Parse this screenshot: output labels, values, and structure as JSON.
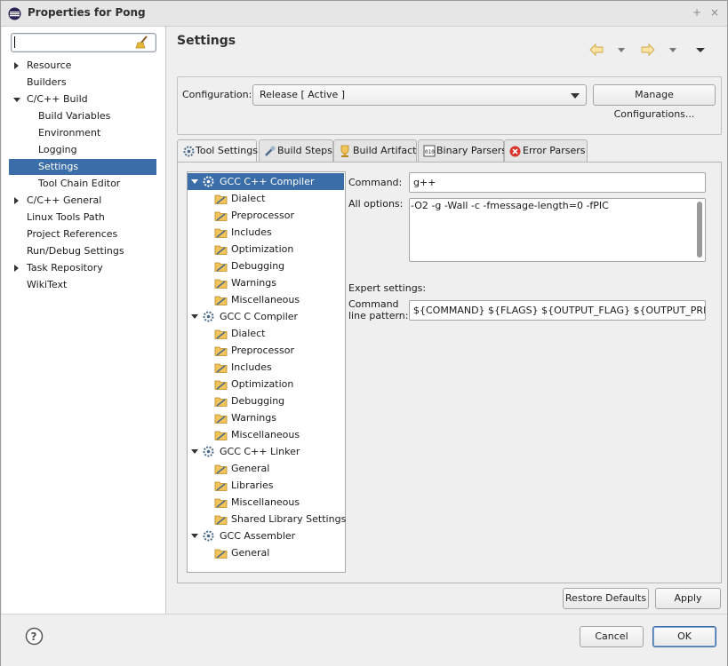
{
  "window": {
    "title": "Properties for Pong",
    "controls": [
      "+",
      "×"
    ]
  },
  "sidebar": {
    "filter_value": "",
    "items": [
      {
        "label": "Resource",
        "expander": "collapsed"
      },
      {
        "label": "Builders",
        "expander": "none"
      },
      {
        "label": "C/C++ Build",
        "expander": "expanded"
      },
      {
        "label": "Build Variables",
        "expander": "none"
      },
      {
        "label": "Environment",
        "expander": "none"
      },
      {
        "label": "Logging",
        "expander": "none"
      },
      {
        "label": "Settings",
        "expander": "none",
        "selected": true
      },
      {
        "label": "Tool Chain Editor",
        "expander": "none"
      },
      {
        "label": "C/C++ General",
        "expander": "collapsed"
      },
      {
        "label": "Linux Tools Path",
        "expander": "none"
      },
      {
        "label": "Project References",
        "expander": "none"
      },
      {
        "label": "Run/Debug Settings",
        "expander": "none"
      },
      {
        "label": "Task Repository",
        "expander": "collapsed"
      },
      {
        "label": "WikiText",
        "expander": "none"
      }
    ]
  },
  "main": {
    "title": "Settings",
    "configuration_label": "Configuration:",
    "configuration_value": "Release  [ Active ]",
    "manage_button": "Manage Configurations...",
    "tabs": [
      {
        "label": "Tool Settings",
        "icon": "tool-settings-icon",
        "active": true
      },
      {
        "label": "Build Steps",
        "icon": "build-steps-icon"
      },
      {
        "label": "Build Artifact",
        "icon": "build-artifact-icon"
      },
      {
        "label": "Binary Parsers",
        "icon": "binary-parsers-icon"
      },
      {
        "label": "Error Parsers",
        "icon": "error-parsers-icon"
      }
    ],
    "tool_tree": [
      {
        "label": "GCC C++ Compiler",
        "type": "tool",
        "selected": true
      },
      {
        "label": "Dialect",
        "type": "option"
      },
      {
        "label": "Preprocessor",
        "type": "option"
      },
      {
        "label": "Includes",
        "type": "option"
      },
      {
        "label": "Optimization",
        "type": "option"
      },
      {
        "label": "Debugging",
        "type": "option"
      },
      {
        "label": "Warnings",
        "type": "option"
      },
      {
        "label": "Miscellaneous",
        "type": "option"
      },
      {
        "label": "GCC C Compiler",
        "type": "tool"
      },
      {
        "label": "Dialect",
        "type": "option"
      },
      {
        "label": "Preprocessor",
        "type": "option"
      },
      {
        "label": "Includes",
        "type": "option"
      },
      {
        "label": "Optimization",
        "type": "option"
      },
      {
        "label": "Debugging",
        "type": "option"
      },
      {
        "label": "Warnings",
        "type": "option"
      },
      {
        "label": "Miscellaneous",
        "type": "option"
      },
      {
        "label": "GCC C++ Linker",
        "type": "tool"
      },
      {
        "label": "General",
        "type": "option"
      },
      {
        "label": "Libraries",
        "type": "option"
      },
      {
        "label": "Miscellaneous",
        "type": "option"
      },
      {
        "label": "Shared Library Settings",
        "type": "option"
      },
      {
        "label": "GCC Assembler",
        "type": "tool"
      },
      {
        "label": "General",
        "type": "option"
      }
    ],
    "command_label": "Command:",
    "command_value": "g++",
    "all_options_label": "All options:",
    "all_options_value": "-O2 -g -Wall -c -fmessage-length=0 -fPIC",
    "expert_label": "Expert settings:",
    "pattern_label_1": "Command",
    "pattern_label_2": "line pattern:",
    "pattern_value": "${COMMAND} ${FLAGS} ${OUTPUT_FLAG} ${OUTPUT_PREFIX}${OUT",
    "restore_defaults": "Restore Defaults",
    "apply": "Apply"
  },
  "footer": {
    "cancel": "Cancel",
    "ok": "OK",
    "help_icon": "help-icon"
  },
  "colors": {
    "selection": "#3b6ea8",
    "folder": "#f2c45c"
  }
}
